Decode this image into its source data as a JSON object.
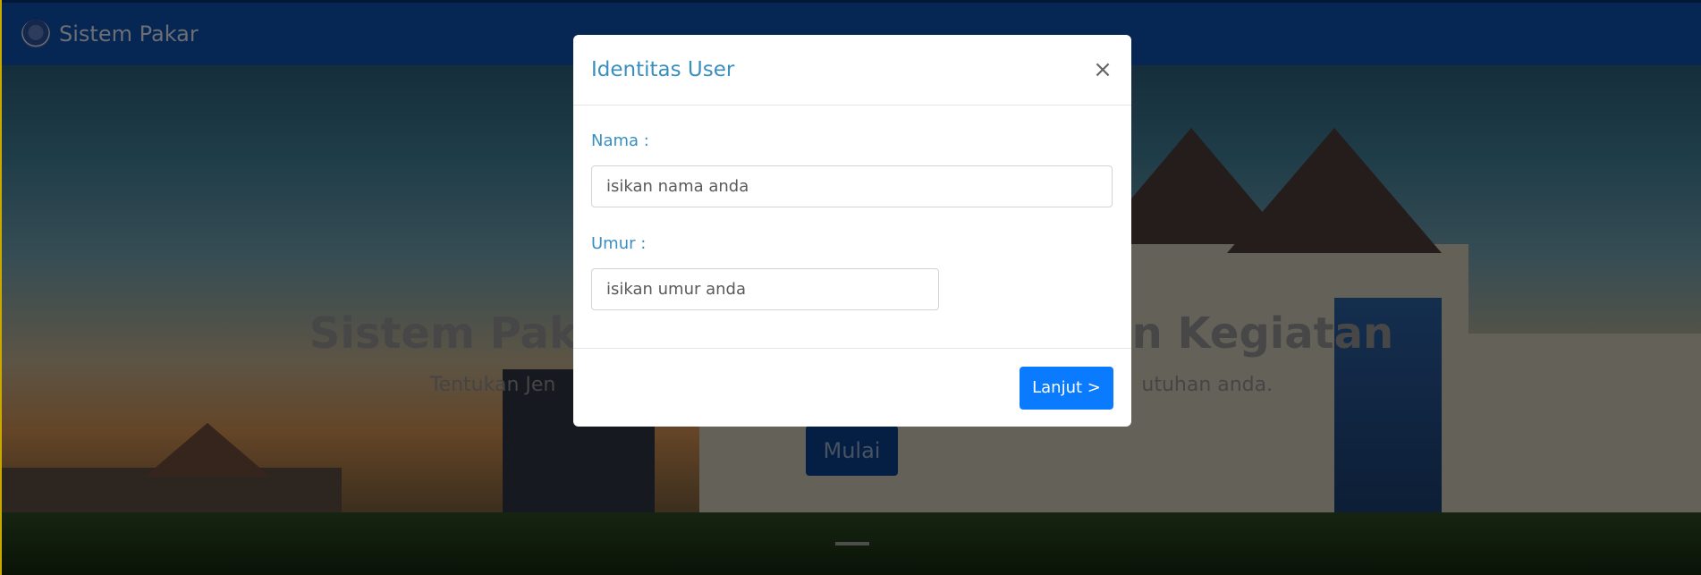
{
  "navbar": {
    "brand": "Sistem Pakar",
    "logo_icon": "university-logo-icon"
  },
  "hero": {
    "title": "Sistem Pakar Penentuan Jenis Kegiatan",
    "title_left": "Sistem Paka",
    "title_right": "an Kegiatan",
    "subtitle_left": "Tentukan Jen",
    "subtitle_right": "utuhan anda.",
    "start_label": "Mulai"
  },
  "modal": {
    "title": "Identitas User",
    "close_icon": "close-icon",
    "close_glyph": "×",
    "name_label": "Nama :",
    "name_placeholder": "isikan nama anda",
    "name_value": "",
    "age_label": "Umur :",
    "age_placeholder": "isikan umur anda",
    "age_value": "",
    "next_label": "Lanjut >"
  },
  "colors": {
    "navbar": "#0d4da8",
    "modal_title": "#3a8fc0",
    "primary_button": "#0a7bff"
  }
}
